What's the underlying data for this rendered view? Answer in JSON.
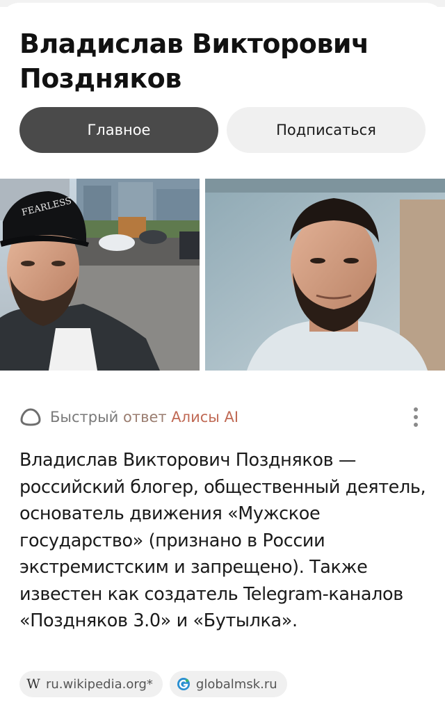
{
  "page": {
    "title": "Владислав Викторович Поздняков"
  },
  "tabs": [
    {
      "label": "Главное",
      "active": true
    },
    {
      "label": "Подписаться",
      "active": false
    }
  ],
  "photos": [
    {
      "caption_text": "FEARLESS"
    },
    {
      "caption_text": ""
    }
  ],
  "alice": {
    "label_part1": "Быстрый ",
    "label_part2": "ответ ",
    "label_part3": "Алисы AI",
    "icon": "alice-ring-icon",
    "menu_icon": "more-vertical-icon"
  },
  "answer": {
    "text": "Владислав Викторович Поздняков — российский блогер, общественный деятель, основатель движения «Мужское государство» (признано в России экстремистским и запрещено). Также известен как создатель Telegram-каналов «Поздняков 3.0» и «Бутылка»."
  },
  "sources": [
    {
      "label": "ru.wikipedia.org*",
      "icon": "wikipedia-icon",
      "icon_glyph": "W"
    },
    {
      "label": "globalmsk.ru",
      "icon": "globalmsk-icon"
    }
  ],
  "colors": {
    "tab_active_bg": "#4a4a4a",
    "tab_inactive_bg": "#f0f0f0",
    "alice_accent": "#c06a55",
    "chip_bg": "#f0f0f0"
  }
}
